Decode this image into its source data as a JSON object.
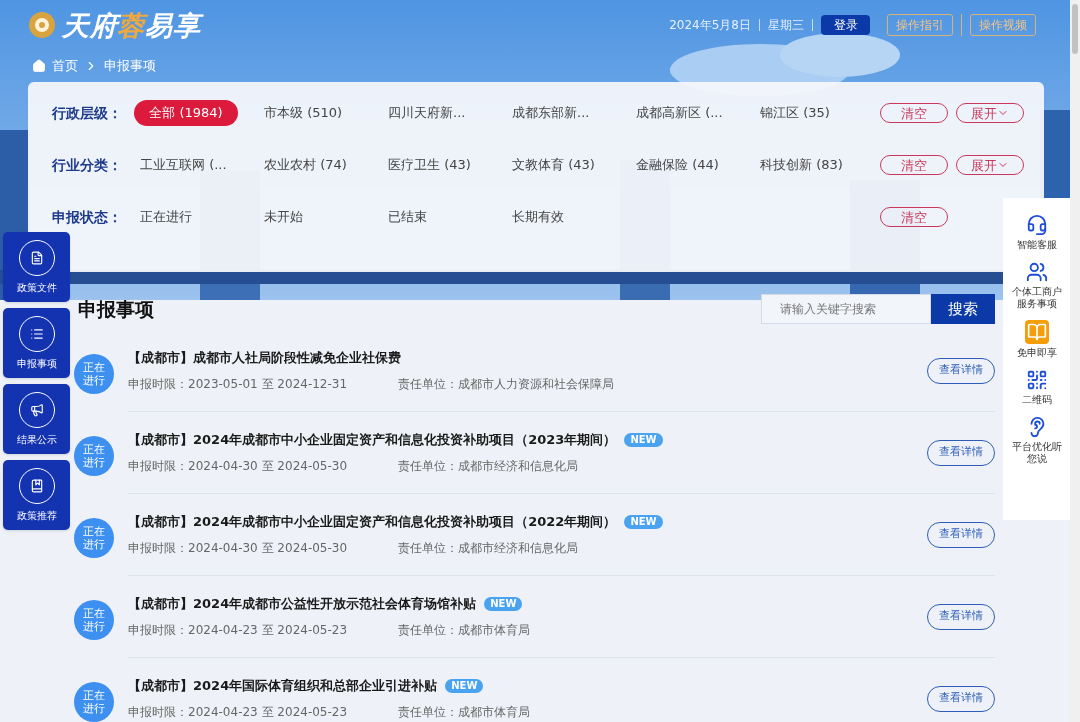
{
  "header": {
    "logo": {
      "part1": "天府",
      "part2": "蓉",
      "part3": "易享"
    },
    "date": "2024年5月8日",
    "weekday": "星期三",
    "login": "登录",
    "links": [
      "操作指引",
      "操作视频"
    ]
  },
  "breadcrumb": [
    "首页",
    "申报事项"
  ],
  "filters": [
    {
      "label": "行政层级：",
      "options": [
        {
          "text": "全部 (1984)",
          "selected": true
        },
        {
          "text": "市本级 (510)",
          "selected": false
        },
        {
          "text": "四川天府新...",
          "selected": false
        },
        {
          "text": "成都东部新...",
          "selected": false
        },
        {
          "text": "成都高新区 (...",
          "selected": false
        },
        {
          "text": "锦江区 (35)",
          "selected": false
        }
      ],
      "clear": "清空",
      "expand": "展开"
    },
    {
      "label": "行业分类：",
      "options": [
        {
          "text": "工业互联网 (...",
          "selected": false
        },
        {
          "text": "农业农村 (74)",
          "selected": false
        },
        {
          "text": "医疗卫生 (43)",
          "selected": false
        },
        {
          "text": "文教体育 (43)",
          "selected": false
        },
        {
          "text": "金融保险 (44)",
          "selected": false
        },
        {
          "text": "科技创新 (83)",
          "selected": false
        }
      ],
      "clear": "清空",
      "expand": "展开"
    },
    {
      "label": "申报状态：",
      "options": [
        {
          "text": "正在进行",
          "selected": false
        },
        {
          "text": "未开始",
          "selected": false
        },
        {
          "text": "已结束",
          "selected": false
        },
        {
          "text": "长期有效",
          "selected": false
        }
      ],
      "clear": "清空"
    }
  ],
  "section_title": "申报事项",
  "search": {
    "placeholder": "请输入关键字搜索",
    "button": "搜索"
  },
  "items": [
    {
      "status": "正在进行",
      "title": "【成都市】成都市人社局阶段性减免企业社保费",
      "new": false,
      "period_label": "申报时限：",
      "period": "2023-05-01 至 2024-12-31",
      "unit_label": "责任单位：",
      "unit": "成都市人力资源和社会保障局",
      "button": "查看详情"
    },
    {
      "status": "正在进行",
      "title": "【成都市】2024年成都市中小企业固定资产和信息化投资补助项目（2023年期间）",
      "new": true,
      "badge": "NEW",
      "period_label": "申报时限：",
      "period": "2024-04-30 至 2024-05-30",
      "unit_label": "责任单位：",
      "unit": "成都市经济和信息化局",
      "button": "查看详情"
    },
    {
      "status": "正在进行",
      "title": "【成都市】2024年成都市中小企业固定资产和信息化投资补助项目（2022年期间）",
      "new": true,
      "badge": "NEW",
      "period_label": "申报时限：",
      "period": "2024-04-30 至 2024-05-30",
      "unit_label": "责任单位：",
      "unit": "成都市经济和信息化局",
      "button": "查看详情"
    },
    {
      "status": "正在进行",
      "title": "【成都市】2024年成都市公益性开放示范社会体育场馆补贴",
      "new": true,
      "badge": "NEW",
      "period_label": "申报时限：",
      "period": "2024-04-23 至 2024-05-23",
      "unit_label": "责任单位：",
      "unit": "成都市体育局",
      "button": "查看详情"
    },
    {
      "status": "正在进行",
      "title": "【成都市】2024年国际体育组织和总部企业引进补贴",
      "new": true,
      "badge": "NEW",
      "period_label": "申报时限：",
      "period": "2024-04-23 至 2024-05-23",
      "unit_label": "责任单位：",
      "unit": "成都市体育局",
      "button": "查看详情"
    }
  ],
  "left_nav": [
    {
      "kind": "file",
      "label": "政策文件"
    },
    {
      "kind": "list",
      "label": "申报事项"
    },
    {
      "kind": "result",
      "label": "结果公示"
    },
    {
      "kind": "recommend",
      "label": "政策推荐"
    }
  ],
  "right_nav": [
    {
      "kind": "service",
      "label": "智能客服"
    },
    {
      "kind": "business",
      "label": "个体工商户服务事项"
    },
    {
      "kind": "exempt",
      "label": "免申即享"
    },
    {
      "kind": "qr",
      "label": "二维码"
    },
    {
      "kind": "ear",
      "label": "平台优化听您说"
    }
  ]
}
